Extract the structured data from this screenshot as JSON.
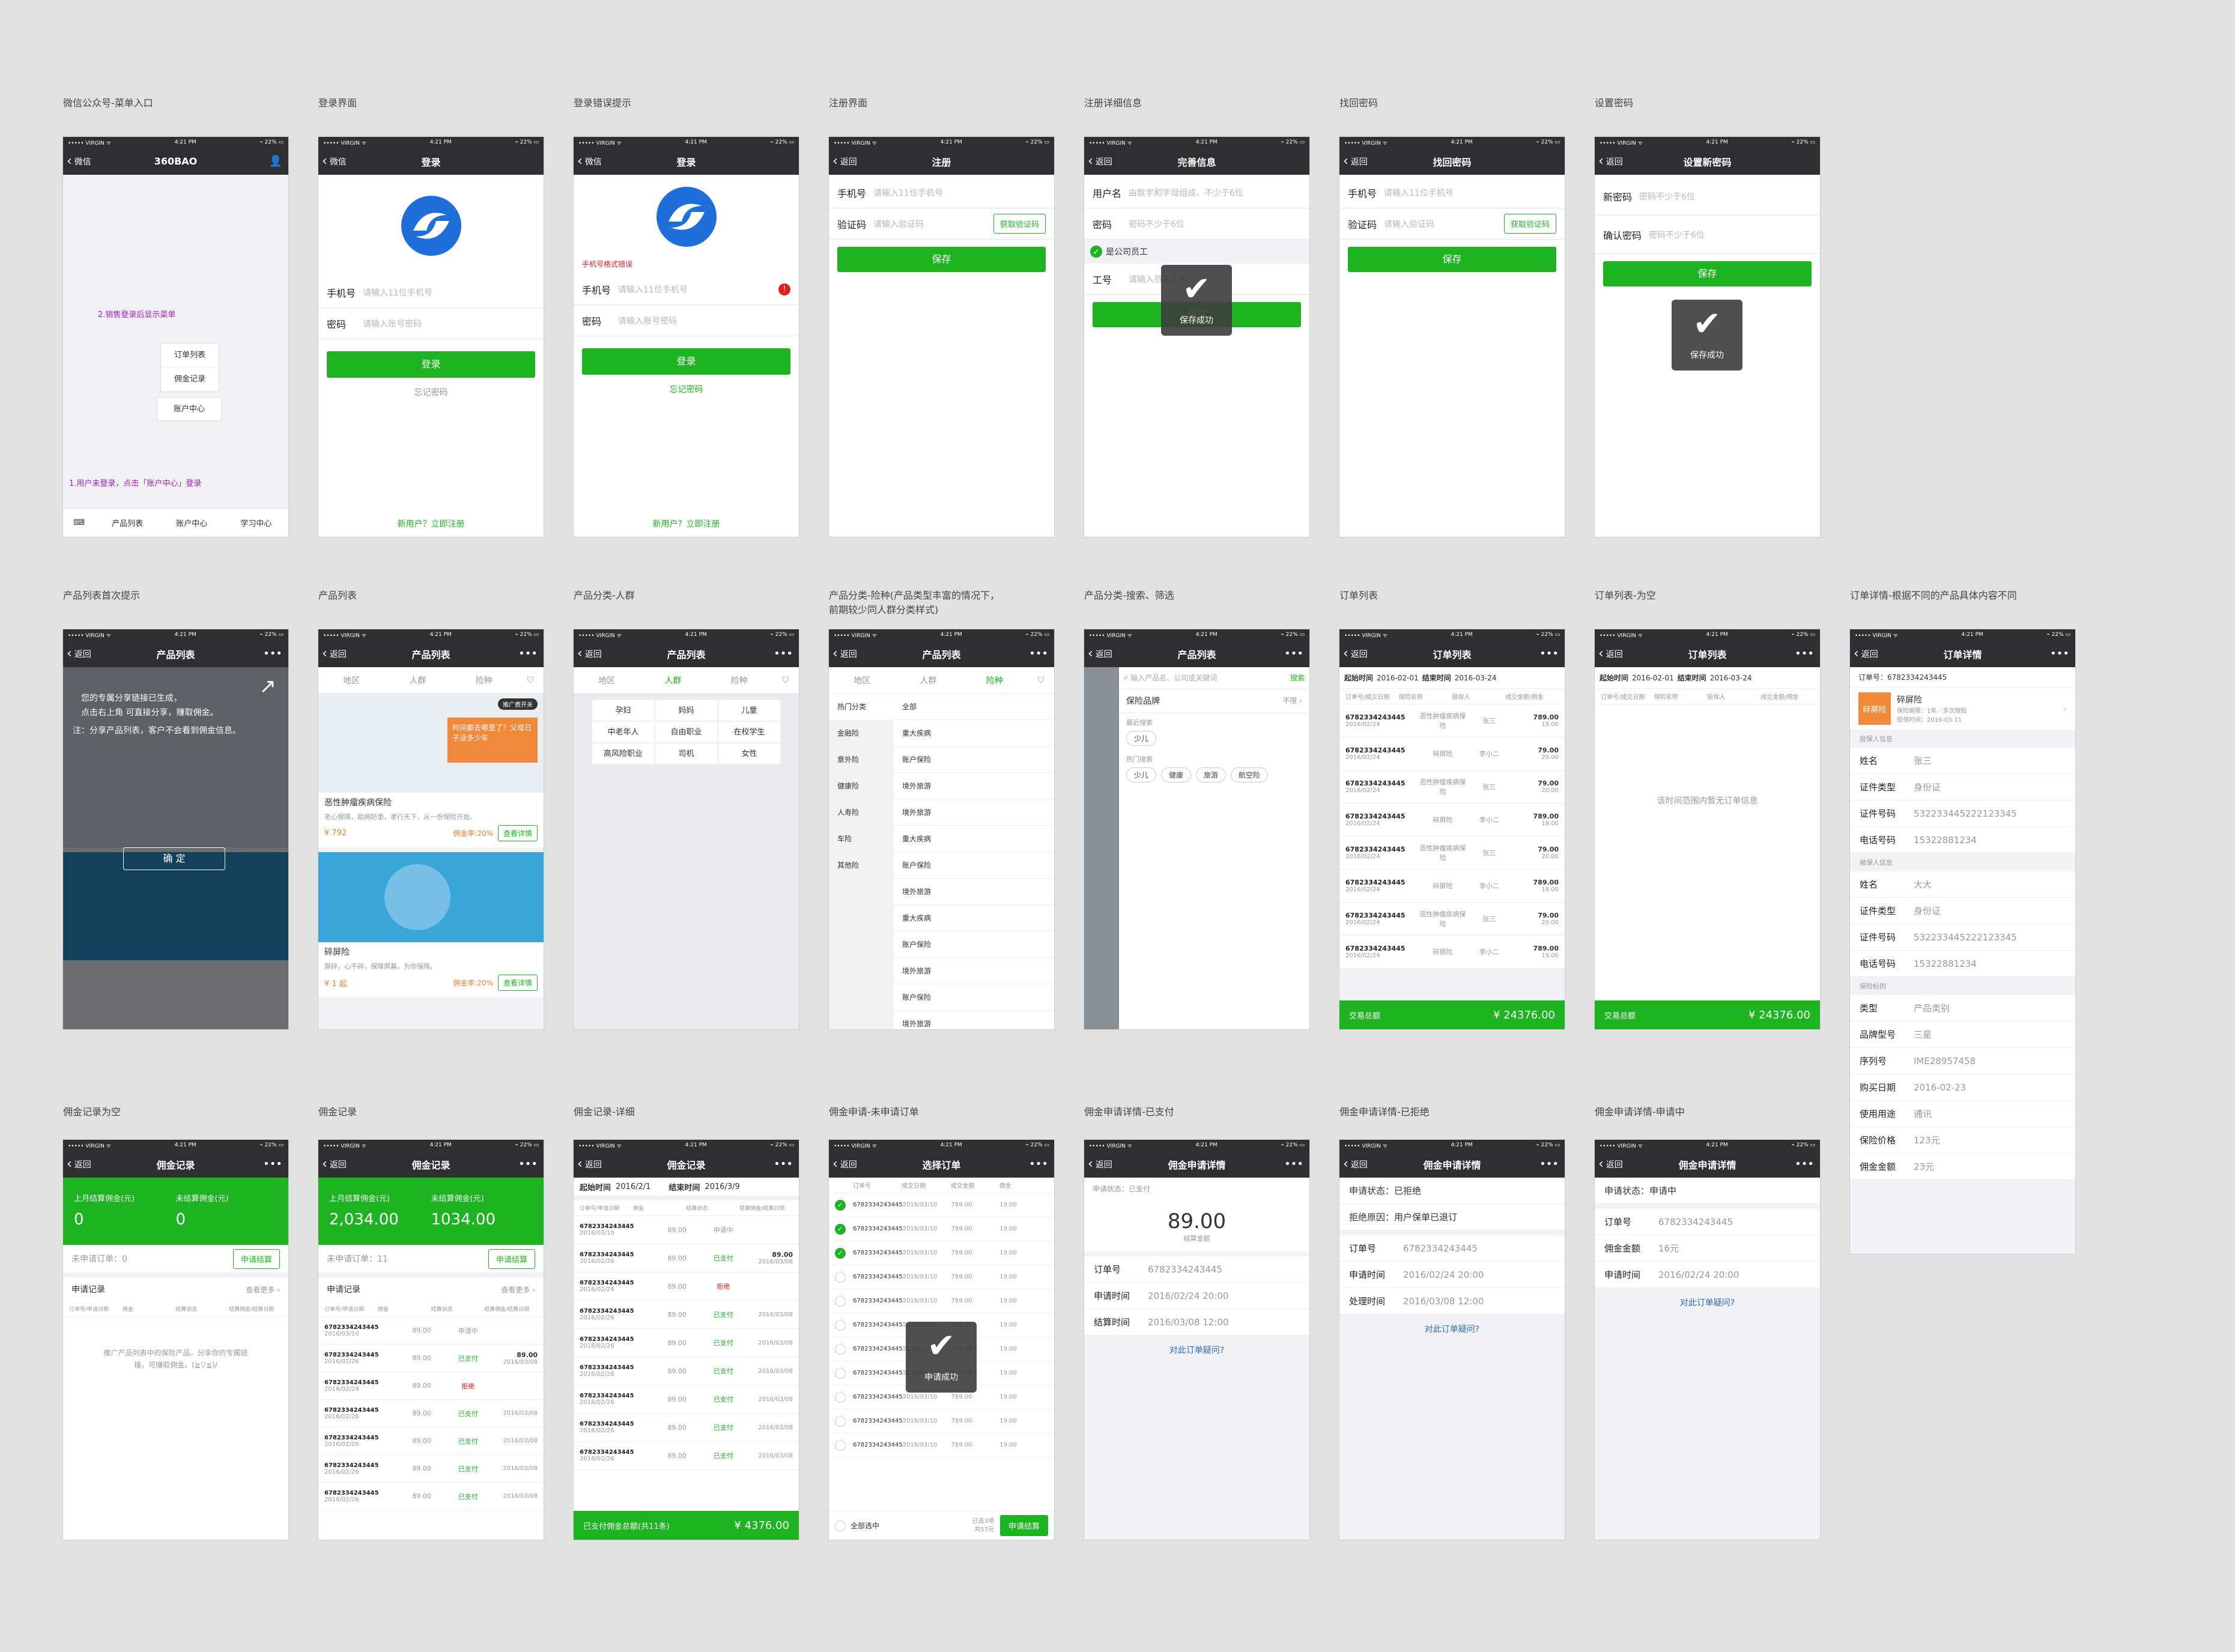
{
  "status": {
    "carrier": "••••• VIRGIN ᯤ",
    "time": "4:21 PM",
    "battery": "⌁ 22% ▭"
  },
  "common": {
    "back": "返回",
    "more": "•••",
    "save": "保存",
    "save_ok": "保存成功",
    "phone_label": "手机号",
    "phone_ph": "请输入11位手机号",
    "code_label": "验证码",
    "code_ph": "请输入验证码",
    "get_code": "获取验证码"
  },
  "captions": {
    "s1": "微信公众号-菜单入口",
    "s2": "登录界面",
    "s3": "登录错误提示",
    "s4": "注册界面",
    "s5": "注册详细信息",
    "s6": "找回密码",
    "s7": "设置密码",
    "s8": "产品列表首次提示",
    "s9": "产品列表",
    "s10": "产品分类-人群",
    "s11": "产品分类-险种(产品类型丰富的情况下，\n前期较少同人群分类样式)",
    "s12": "产品分类-搜索、筛选",
    "s13": "订单列表",
    "s14": "订单列表-为空",
    "s15": "订单详情-根据不同的产品具体内容不同",
    "s16": "佣金记录为空",
    "s17": "佣金记录",
    "s18": "佣金记录-详细",
    "s19": "佣金申请-未申请订单",
    "s20": "佣金申请详情-已支付",
    "s21": "佣金申请详情-已拒绝",
    "s22": "佣金申请详情-申请中"
  },
  "s1": {
    "back": "微信",
    "title": "360BAO",
    "hint2": "2.销售登录后显示菜单",
    "m1": "订单列表",
    "m2": "佣金记录",
    "m3": "账户中心",
    "hint1": "1.用户未登录，点击「账户中心」登录",
    "tab1": "产品列表",
    "tab2": "账户中心",
    "tab3": "学习中心"
  },
  "s2": {
    "back": "微信",
    "title": "登录",
    "pwd_label": "密码",
    "pwd_ph": "请输入账号密码",
    "login": "登录",
    "forgot": "忘记密码",
    "reg": "新用户？立即注册"
  },
  "s3": {
    "err": "手机号格式错误"
  },
  "s4": {
    "title": "注册"
  },
  "s5": {
    "title": "完善信息",
    "user": "用户名",
    "user_ph": "由数字和字母组成，不少于6位",
    "pwd": "密码",
    "pwd_ph": "密码不少于6位",
    "staff": "是公司员工",
    "emp": "工号",
    "emp_ph": "请输入员工工号"
  },
  "s6": {
    "title": "找回密码"
  },
  "s7": {
    "title": "设置新密码",
    "np": "新密码",
    "np_ph": "密码不少于6位",
    "cp": "确认密码",
    "cp_ph": "密码不少于6位"
  },
  "s8": {
    "tip1": "您的专属分享链接已生成，",
    "tip2": "点击右上角  可直接分享，赚取佣金。",
    "tip3": "注：分享产品列表，客户不会看到佣金信息。",
    "ok": "确 定",
    "badge": "推广费开关"
  },
  "prod": {
    "title": "产品列表",
    "f1": "地区",
    "f2": "人群",
    "f3": "险种",
    "badge": "推广费开关",
    "p1": "恶性肿瘤疾病保险",
    "p1d": "老心保障，助病防患，孝行天下，从一份保险开始。",
    "p1p": "¥ 792",
    "rate": "佣金率:20%",
    "detail": "查看详情",
    "p2": "碎屏险",
    "p2d": "屏碎，心不碎，保障屏幕，为你保障。",
    "p2p": "¥ 1 起",
    "ad": "时间都去哪里了？父母日子没多少年"
  },
  "s10": {
    "tags": [
      "孕妇",
      "妈妈",
      "儿童",
      "中老年人",
      "自由职业",
      "在校学生",
      "高风险职业",
      "司机",
      "女性"
    ]
  },
  "s11": {
    "left": [
      "热门分类",
      "金融险",
      "意外险",
      "健康险",
      "人寿险",
      "车险",
      "其他险"
    ],
    "right": [
      "全部",
      "重大疾病",
      "账户保险",
      "境外旅游",
      "境外旅游",
      "重大疾病",
      "账户保险",
      "境外旅游",
      "重大疾病",
      "账户保险",
      "境外旅游",
      "账户保险",
      "境外旅游"
    ]
  },
  "s12": {
    "search_ph": "输入产品名、公司或关键词",
    "search": "搜索",
    "brand": "保险品牌",
    "nolimit": "不限 ›",
    "recent": "最近搜索",
    "hot": "热门搜索",
    "recent_tags": [
      "少儿"
    ],
    "hot_tags": [
      "少儿",
      "健康",
      "旅游",
      "航空险"
    ]
  },
  "orders": {
    "title": "订单列表",
    "start_l": "起始时间",
    "start": "2016-02-01",
    "end_l": "结束时间",
    "end": "2016-03-24",
    "heads": [
      "订单号/成交日期",
      "保险名称",
      "投保人",
      "成交金额/佣金"
    ],
    "total_l": "交易总额",
    "total": "¥ 24376.00",
    "empty": "该时间范围内暂无订单信息",
    "rows": [
      [
        "6782334243445",
        "2016/02/24",
        "恶性肿瘤疾病保险",
        "张三",
        "789.00",
        "19.00"
      ],
      [
        "6782334243445",
        "2016/02/24",
        "碎屏险",
        "李小二",
        "79.00",
        "20.00"
      ],
      [
        "6782334243445",
        "2016/02/24",
        "恶性肿瘤疾病保险",
        "张三",
        "79.00",
        "20.00"
      ],
      [
        "6782334243445",
        "2016/02/24",
        "碎屏险",
        "李小二",
        "789.00",
        "19.00"
      ],
      [
        "6782334243445",
        "2016/02/24",
        "恶性肿瘤疾病保险",
        "张三",
        "79.00",
        "20.00"
      ],
      [
        "6782334243445",
        "2016/02/24",
        "碎屏险",
        "李小二",
        "789.00",
        "19.00"
      ],
      [
        "6782334243445",
        "2016/02/24",
        "恶性肿瘤疾病保险",
        "张三",
        "79.00",
        "20.00"
      ],
      [
        "6782334243445",
        "2016/02/24",
        "碎屏险",
        "李小二",
        "789.00",
        "19.00"
      ]
    ]
  },
  "s15": {
    "title": "订单详情",
    "order": "订单号：6782334243445",
    "pname": "碎屏险",
    "pmeta": "保险期限：1年／多次理赔",
    "pdate": "投保时间：2016-03-11",
    "sec1": "投保人信息",
    "sec2": "被保人信息",
    "sec3": "保险标的",
    "a": [
      [
        "姓名",
        "张三"
      ],
      [
        "证件类型",
        "身份证"
      ],
      [
        "证件号码",
        "532233445222123345"
      ],
      [
        "电话号码",
        "15322881234"
      ]
    ],
    "b": [
      [
        "姓名",
        "大大"
      ],
      [
        "证件类型",
        "身份证"
      ],
      [
        "证件号码",
        "532233445222123345"
      ],
      [
        "电话号码",
        "15322881234"
      ]
    ],
    "c": [
      [
        "类型",
        "产品类别"
      ],
      [
        "品牌型号",
        "三星"
      ],
      [
        "序列号",
        "IME28957458"
      ],
      [
        "购买日期",
        "2016-02-23"
      ],
      [
        "使用用途",
        "通讯"
      ],
      [
        "保险价格",
        "123元"
      ],
      [
        "佣金金额",
        "23元"
      ]
    ]
  },
  "comm": {
    "title": "佣金记录",
    "last_l": "上月结算佣金(元)",
    "pend_l": "未结算佣金(元)",
    "unapplied": "未申请订单：",
    "apply": "申请结算",
    "record": "申请记录",
    "more": "查看更多 ›",
    "heads": [
      "订单号/申请日期",
      "佣金",
      "结算状态",
      "结算佣金/结算日期"
    ],
    "empty_tip": "推广产品列表中的保险产品，分享你的专属链接，可赚取佣金。(≧▽≦)/",
    "e_last": "0",
    "e_pend": "0",
    "e_cnt": "0",
    "last": "2,034.00",
    "pend": "1034.00",
    "cnt": "11",
    "rows": [
      [
        "6782334243445",
        "2016/03/10",
        "89.00",
        "申请中",
        "",
        ""
      ],
      [
        "6782334243445",
        "2016/02/26",
        "89.00",
        "已支付",
        "89.00",
        "2016/03/08"
      ],
      [
        "6782334243445",
        "2016/02/24",
        "89.00",
        "拒绝",
        "",
        ""
      ],
      [
        "6782334243445",
        "2016/02/26",
        "89.00",
        "已支付",
        "",
        "2016/03/08"
      ],
      [
        "6782334243445",
        "2016/02/26",
        "89.00",
        "已支付",
        "",
        "2016/03/08"
      ],
      [
        "6782334243445",
        "2016/02/26",
        "89.00",
        "已支付",
        "",
        "2016/03/08"
      ],
      [
        "6782334243445",
        "2016/02/26",
        "89.00",
        "已支付",
        "",
        "2016/03/08"
      ],
      [
        "6782334243445",
        "2016/02/26",
        "89.00",
        "已支付",
        "",
        "2016/03/08"
      ],
      [
        "6782334243445",
        "2016/02/26",
        "89.00",
        "已支付",
        "",
        "2016/03/08"
      ]
    ],
    "s18_start_l": "起始时间",
    "s18_start": "2016/2/1",
    "s18_end_l": "结束时间",
    "s18_end": "2016/3/9",
    "s18_total_l": "已支付佣金总额(共11条)",
    "s18_total": "¥ 4376.00"
  },
  "s19": {
    "title": "选择订单",
    "heads": [
      "订单号",
      "成交日期",
      "成交金额",
      "佣金"
    ],
    "row": [
      "6782334243445",
      "2016/03/10",
      "789.00",
      "19.00"
    ],
    "all": "全部选中",
    "sel": "已选3项",
    "sum": "共57元",
    "apply": "申请结算",
    "toast": "申请成功"
  },
  "s20": {
    "title": "佣金申请详情",
    "status": "申请状态：已支付",
    "amount": "89.00",
    "amount_l": "结算金额",
    "k1": "订单号",
    "v1": "6782334243445",
    "k2": "申请时间",
    "v2": "2016/02/24  20:00",
    "k3": "结算时间",
    "v3": "2016/03/08  12:00",
    "q": "对此订单疑问?"
  },
  "s21": {
    "status": "申请状态：已拒绝",
    "reason": "拒绝原因：用户保单已退订",
    "k1": "订单号",
    "v1": "6782334243445",
    "k2": "申请时间",
    "v2": "2016/02/24  20:00",
    "k3": "处理时间",
    "v3": "2016/03/08  12:00",
    "q": "对此订单疑问?"
  },
  "s22": {
    "status": "申请状态：申请中",
    "k1": "订单号",
    "v1": "6782334243445",
    "k2": "佣金金额",
    "v2": "16元",
    "k3": "申请时间",
    "v3": "2016/02/24  20:00",
    "q": "对此订单疑问?"
  }
}
